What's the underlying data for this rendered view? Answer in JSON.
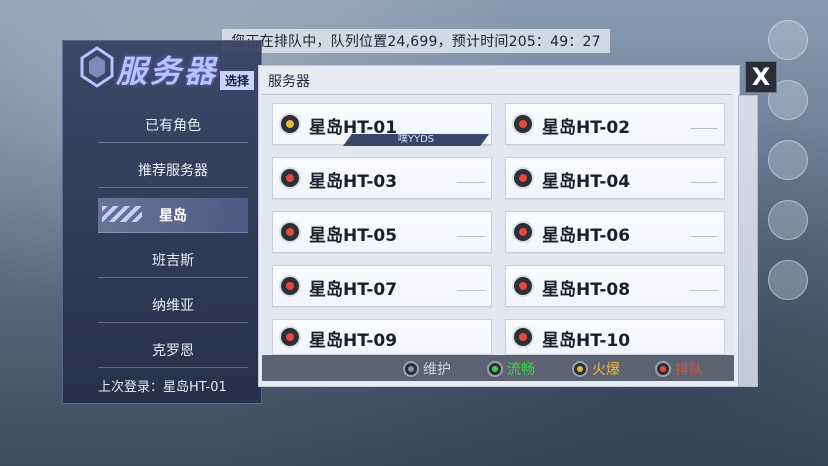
{
  "queue_status": "您正在排队中，队列位置24,699，预计时间205：49：27",
  "left_panel": {
    "title": "服务器",
    "title_sub": "选择",
    "nav": [
      {
        "label": "已有角色",
        "active": false
      },
      {
        "label": "推荐服务器",
        "active": false
      },
      {
        "label": "星岛",
        "active": true
      },
      {
        "label": "班吉斯",
        "active": false
      },
      {
        "label": "纳维亚",
        "active": false
      },
      {
        "label": "克罗恩",
        "active": false
      }
    ],
    "last_login": "上次登录：星岛HT-01"
  },
  "main": {
    "header": "服务器",
    "servers": [
      {
        "name": "星岛HT-01",
        "status": "yellow",
        "tag": "噗YYDS"
      },
      {
        "name": "星岛HT-02",
        "status": "red"
      },
      {
        "name": "星岛HT-03",
        "status": "red"
      },
      {
        "name": "星岛HT-04",
        "status": "red"
      },
      {
        "name": "星岛HT-05",
        "status": "red"
      },
      {
        "name": "星岛HT-06",
        "status": "red"
      },
      {
        "name": "星岛HT-07",
        "status": "red"
      },
      {
        "name": "星岛HT-08",
        "status": "red"
      },
      {
        "name": "星岛HT-09",
        "status": "red"
      },
      {
        "name": "星岛HT-10",
        "status": "red"
      }
    ],
    "legend": [
      {
        "label": "维护",
        "color": "#d5d8de",
        "icon": "grey-status-dot"
      },
      {
        "label": "流畅",
        "color": "#3cd24a",
        "icon": "green-status-dot"
      },
      {
        "label": "火爆",
        "color": "#e3b83c",
        "icon": "yellow-status-dot"
      },
      {
        "label": "排队",
        "color": "#e34a3c",
        "icon": "red-status-dot"
      }
    ]
  },
  "close_icon": "X",
  "colors": {
    "accent": "#b7c4ff",
    "panel": "#373f60",
    "status_red": "#e34a3c",
    "status_yellow": "#e3b83c",
    "status_green": "#3cd24a"
  }
}
